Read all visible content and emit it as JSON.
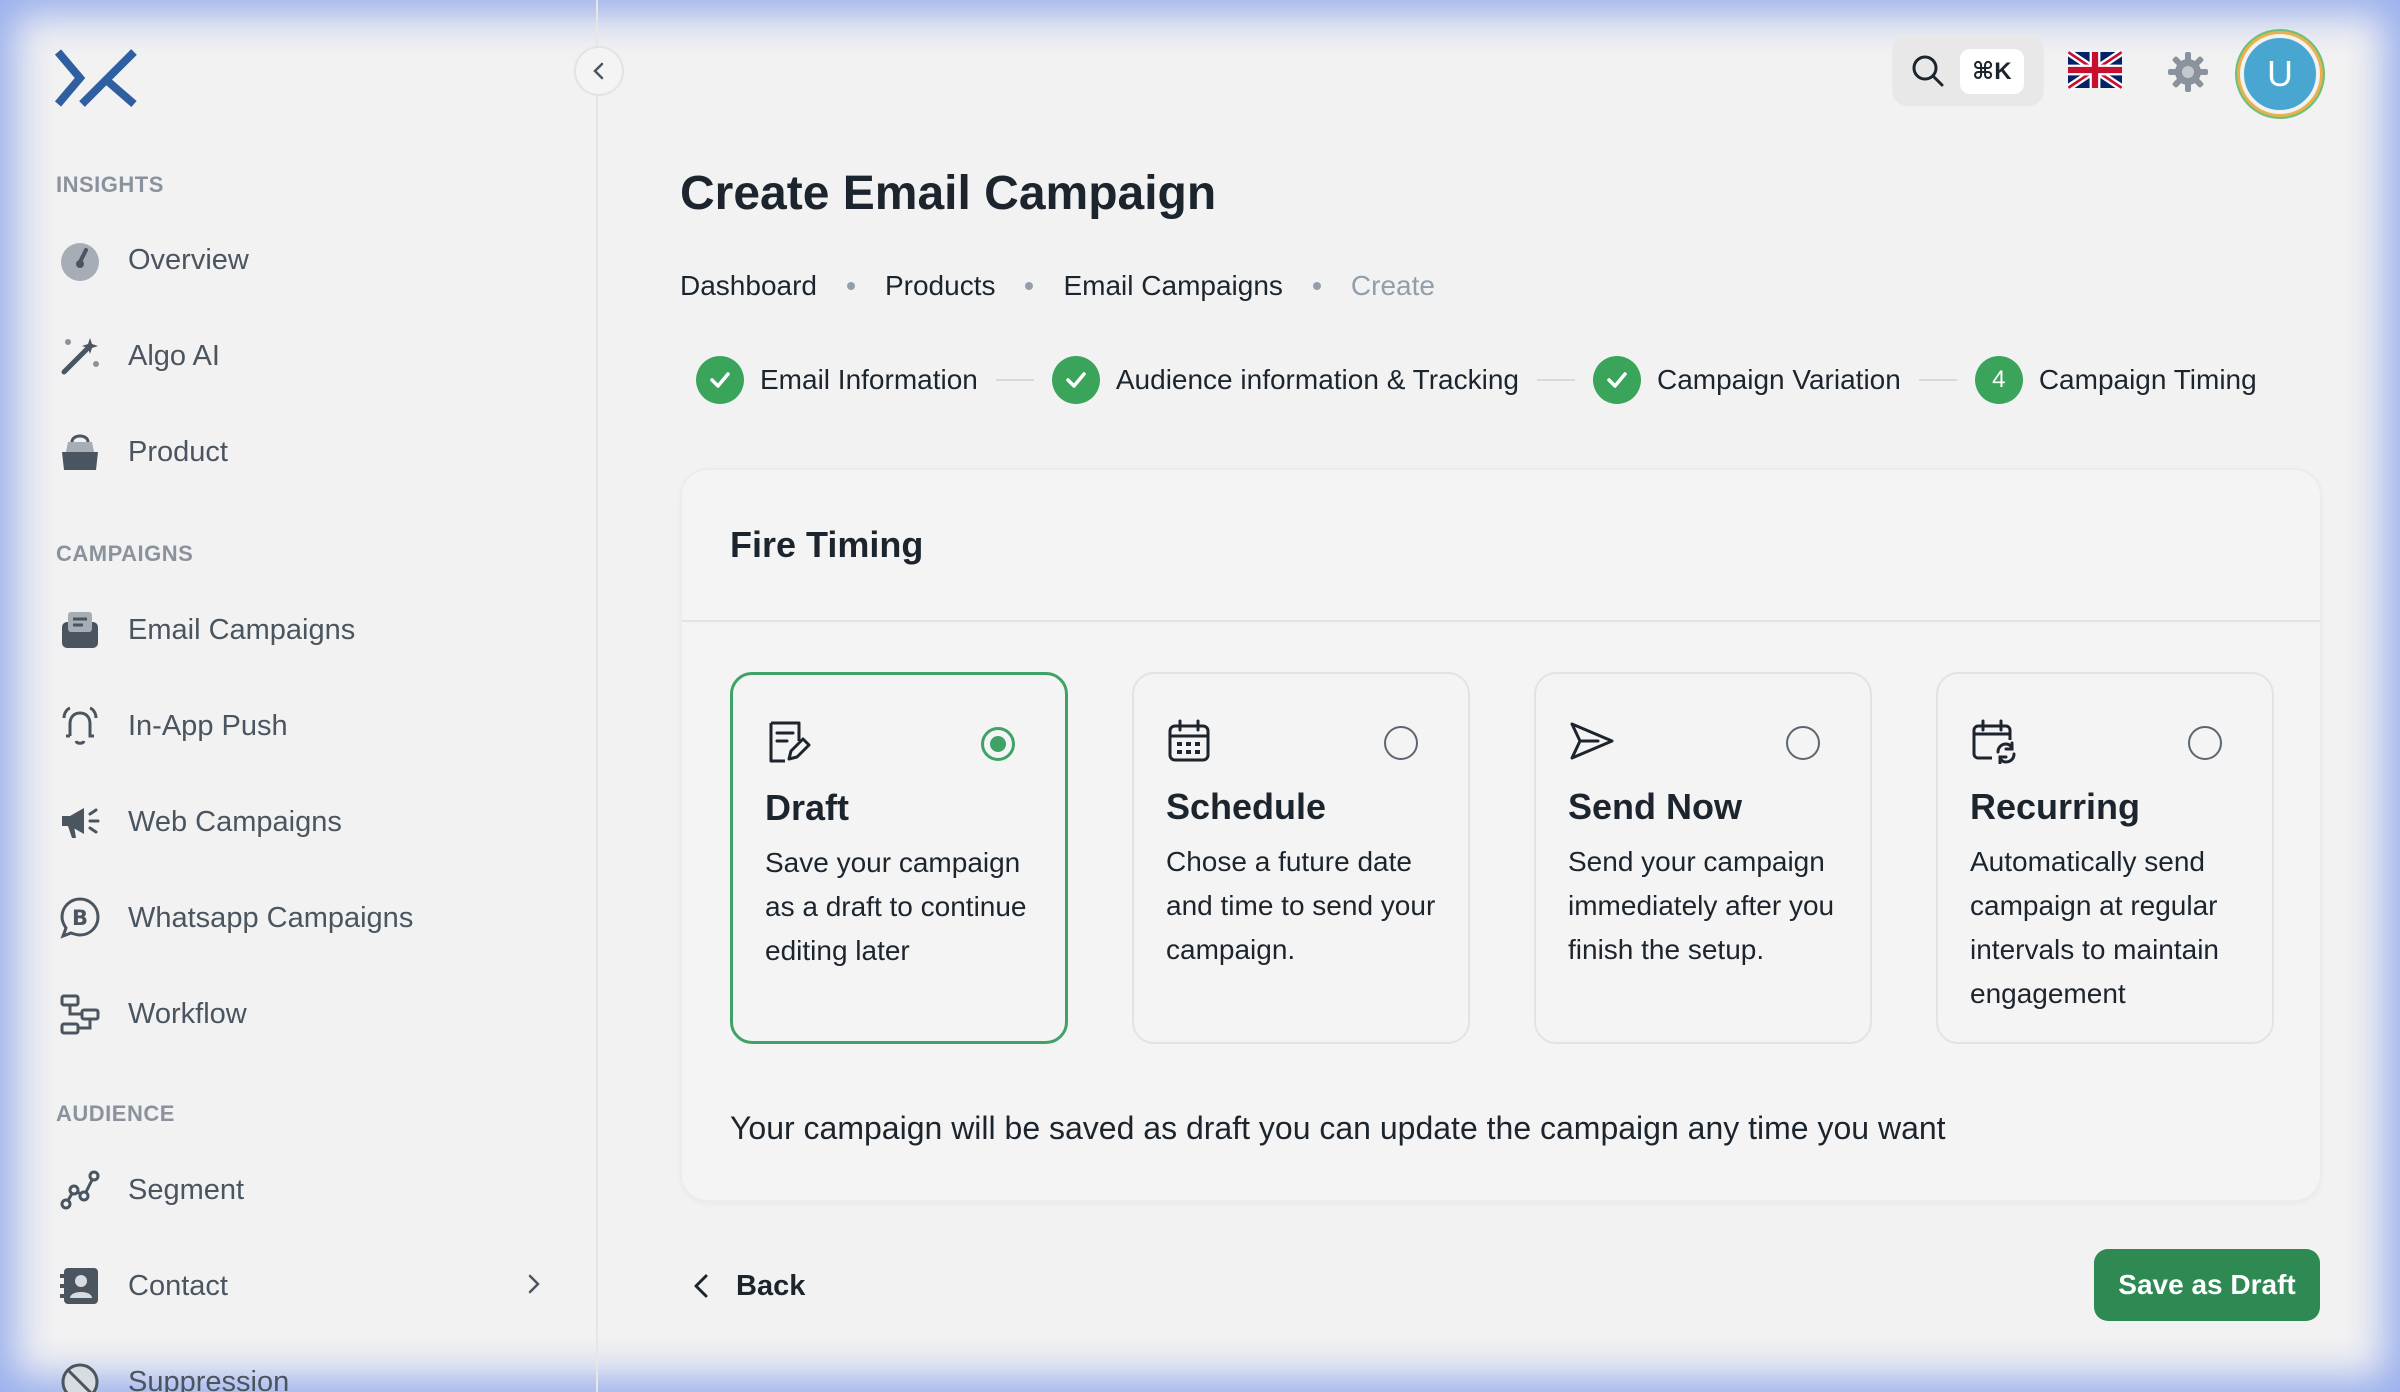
{
  "sidebar": {
    "sections": {
      "insights": "INSIGHTS",
      "campaigns": "CAMPAIGNS",
      "audience": "AUDIENCE"
    },
    "items": [
      {
        "label": "Overview",
        "icon": "gauge-icon"
      },
      {
        "label": "Algo AI",
        "icon": "magic-wand-icon"
      },
      {
        "label": "Product",
        "icon": "shopping-bag-icon"
      },
      {
        "label": "Email Campaigns",
        "icon": "inbox-icon"
      },
      {
        "label": "In-App Push",
        "icon": "bell-ringing-icon"
      },
      {
        "label": "Web Campaigns",
        "icon": "megaphone-icon"
      },
      {
        "label": "Whatsapp Campaigns",
        "icon": "whatsapp-business-icon"
      },
      {
        "label": "Workflow",
        "icon": "workflow-icon"
      },
      {
        "label": "Segment",
        "icon": "segment-icon"
      },
      {
        "label": "Contact",
        "icon": "contact-card-icon"
      },
      {
        "label": "Suppression",
        "icon": "block-icon"
      }
    ]
  },
  "topbar": {
    "shortcut": "⌘K",
    "avatar_initial": "U"
  },
  "page": {
    "title": "Create Email Campaign",
    "breadcrumb": [
      "Dashboard",
      "Products",
      "Email Campaigns",
      "Create"
    ]
  },
  "stepper": {
    "steps": [
      {
        "label": "Email Information",
        "state": "done"
      },
      {
        "label": "Audience information & Tracking",
        "state": "done"
      },
      {
        "label": "Campaign Variation",
        "state": "done"
      },
      {
        "label": "Campaign Timing",
        "state": "active",
        "number": "4"
      }
    ]
  },
  "fire_timing": {
    "title": "Fire Timing",
    "options": [
      {
        "title": "Draft",
        "desc": "Save your campaign as a draft to continue editing later",
        "selected": true,
        "icon": "draft-note-icon"
      },
      {
        "title": "Schedule",
        "desc": "Chose a future date and time to send your campaign.",
        "selected": false,
        "icon": "calendar-icon"
      },
      {
        "title": "Send Now",
        "desc": "Send your campaign immediately after you finish the setup.",
        "selected": false,
        "icon": "send-icon"
      },
      {
        "title": "Recurring",
        "desc": "Automatically send campaign at regular intervals to maintain engagement",
        "selected": false,
        "icon": "calendar-repeat-icon"
      }
    ],
    "notice": "Your campaign will be saved as draft you can update the campaign any time you want"
  },
  "footer": {
    "back_label": "Back",
    "save_label": "Save as Draft"
  },
  "colors": {
    "accent": "#2e8a52",
    "step_done": "#39a45a",
    "logo": "#2f5fa0"
  }
}
